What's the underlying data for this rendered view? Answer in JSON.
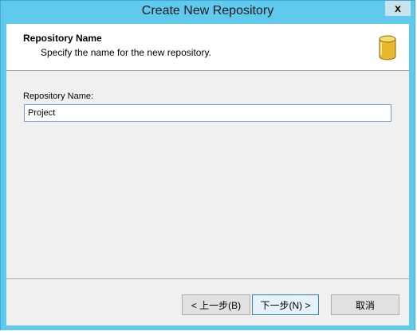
{
  "window": {
    "title": "Create New Repository",
    "close_label": "x"
  },
  "header": {
    "title": "Repository Name",
    "subtitle": "Specify the name for the new repository.",
    "icon": "database-icon"
  },
  "form": {
    "label": "Repository Name:",
    "value": "Project"
  },
  "buttons": {
    "back": "< 上一步(B)",
    "next": "下一步(N) >",
    "cancel": "取消"
  },
  "colors": {
    "titlebar": "#5fc9ee",
    "client": "#f0f0f0",
    "icon_gold": "#e8b72c"
  }
}
